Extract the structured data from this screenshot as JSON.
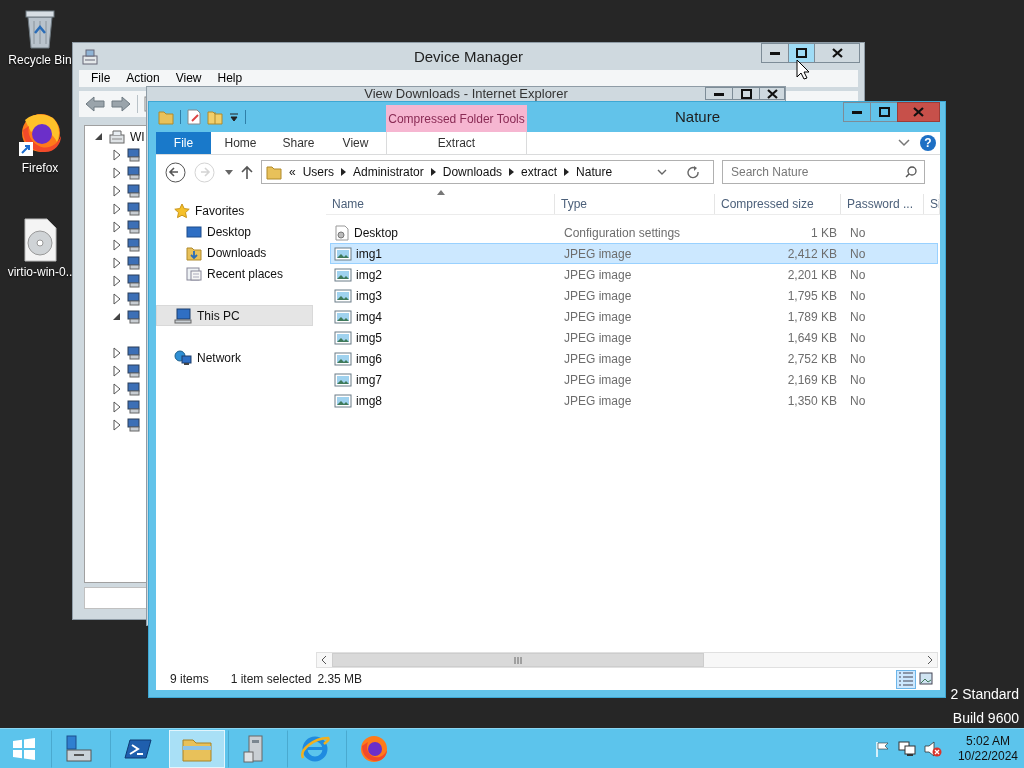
{
  "desktop_icons": [
    {
      "label": "Recycle Bin",
      "kind": "recycle_bin"
    },
    {
      "label": "Firefox",
      "kind": "firefox"
    },
    {
      "label": "virtio-win-0..",
      "kind": "disc"
    }
  ],
  "device_manager": {
    "title": "Device Manager",
    "buttons": [
      {
        "kind": "minimize",
        "hovered": false
      },
      {
        "kind": "maximize",
        "hovered": true
      },
      {
        "kind": "close",
        "hovered": false
      }
    ],
    "menu": [
      "File",
      "Action",
      "View",
      "Help"
    ],
    "tree": {
      "label": "WI",
      "expanded": true,
      "children": [
        {
          "expanded": false
        },
        {
          "expanded": false
        },
        {
          "expanded": false
        },
        {
          "expanded": false
        },
        {
          "expanded": false
        },
        {
          "expanded": false
        },
        {
          "expanded": false
        },
        {
          "expanded": false
        },
        {
          "expanded": false
        },
        {
          "expanded": true
        },
        {
          "expanded": false
        },
        {
          "expanded": false
        },
        {
          "expanded": false
        },
        {
          "expanded": false
        },
        {
          "expanded": false
        }
      ]
    }
  },
  "ie_window": {
    "title": "View Downloads - Internet Explorer"
  },
  "explorer": {
    "title": "Nature",
    "context_group": "Compressed Folder Tools",
    "tabs": [
      {
        "label": "File",
        "kind": "file"
      },
      {
        "label": "Home",
        "kind": "tab"
      },
      {
        "label": "Share",
        "kind": "tab"
      },
      {
        "label": "View",
        "kind": "tab"
      },
      {
        "label": "Extract",
        "kind": "context"
      }
    ],
    "help": "?",
    "nav_buttons": [
      {
        "kind": "back",
        "disabled": false
      },
      {
        "kind": "forward",
        "disabled": true
      }
    ],
    "address": {
      "overflow": "«",
      "crumbs": [
        "Users",
        "Administrator",
        "Downloads",
        "extract",
        "Nature"
      ]
    },
    "search": {
      "placeholder": "Search Nature"
    },
    "nav": [
      {
        "label": "Favorites",
        "kind": "favorites",
        "selected": false,
        "children": [
          {
            "label": "Desktop",
            "kind": "desktop",
            "selected": false
          },
          {
            "label": "Downloads",
            "kind": "downloads",
            "selected": false
          },
          {
            "label": "Recent places",
            "kind": "recent",
            "selected": false
          }
        ]
      },
      {
        "label": "This PC",
        "kind": "pc",
        "selected": true
      },
      {
        "label": "Network",
        "kind": "network",
        "selected": false
      }
    ],
    "columns": [
      {
        "label": "Name",
        "sorted": true
      },
      {
        "label": "Type",
        "sorted": false
      },
      {
        "label": "Compressed size",
        "sorted": false
      },
      {
        "label": "Password ...",
        "sorted": false
      },
      {
        "label": "Si",
        "sorted": false
      }
    ],
    "rows": [
      {
        "name": "Desktop",
        "type": "Configuration settings",
        "size": "1 KB",
        "password": "No",
        "kind": "config",
        "selected": false
      },
      {
        "name": "img1",
        "type": "JPEG image",
        "size": "2,412 KB",
        "password": "No",
        "kind": "image",
        "selected": true
      },
      {
        "name": "img2",
        "type": "JPEG image",
        "size": "2,201 KB",
        "password": "No",
        "kind": "image",
        "selected": false
      },
      {
        "name": "img3",
        "type": "JPEG image",
        "size": "1,795 KB",
        "password": "No",
        "kind": "image",
        "selected": false
      },
      {
        "name": "img4",
        "type": "JPEG image",
        "size": "1,789 KB",
        "password": "No",
        "kind": "image",
        "selected": false
      },
      {
        "name": "img5",
        "type": "JPEG image",
        "size": "1,649 KB",
        "password": "No",
        "kind": "image",
        "selected": false
      },
      {
        "name": "img6",
        "type": "JPEG image",
        "size": "2,752 KB",
        "password": "No",
        "kind": "image",
        "selected": false
      },
      {
        "name": "img7",
        "type": "JPEG image",
        "size": "2,169 KB",
        "password": "No",
        "kind": "image",
        "selected": false
      },
      {
        "name": "img8",
        "type": "JPEG image",
        "size": "1,350 KB",
        "password": "No",
        "kind": "image",
        "selected": false
      }
    ],
    "status": {
      "count": "9 items",
      "selection": "1 item selected",
      "size": "2.35 MB"
    },
    "view_buttons": [
      {
        "kind": "details",
        "selected": true
      },
      {
        "kind": "large_icons",
        "selected": false
      }
    ]
  },
  "edition_text": [
    "2 Standard",
    "Build 9600"
  ],
  "taskbar": {
    "apps": [
      {
        "kind": "start",
        "active": false
      },
      {
        "kind": "server_manager",
        "active": false
      },
      {
        "kind": "powershell",
        "active": false
      },
      {
        "kind": "explorer",
        "active": true
      },
      {
        "kind": "device_manager",
        "active": false
      },
      {
        "kind": "ie",
        "active": false
      },
      {
        "kind": "firefox",
        "active": false
      }
    ],
    "tray": [
      {
        "kind": "flag"
      },
      {
        "kind": "network"
      },
      {
        "kind": "volume_muted"
      }
    ],
    "clock": {
      "time": "5:02 AM",
      "date": "10/22/2024"
    }
  }
}
